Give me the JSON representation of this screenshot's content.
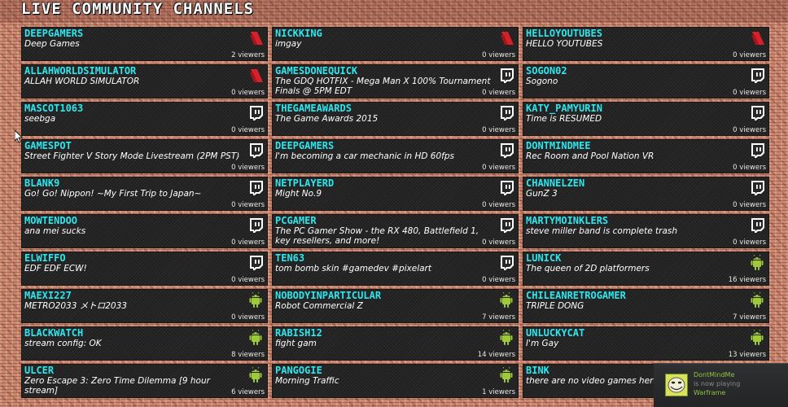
{
  "header": {
    "title": "Live Community Channels"
  },
  "viewers_suffix": "viewers",
  "channels": [
    {
      "name": "DeepGamers",
      "title": "Deep Games",
      "viewers": 2,
      "platform": "youtube"
    },
    {
      "name": "Nickking",
      "title": "imgay",
      "viewers": 0,
      "platform": "youtube"
    },
    {
      "name": "HelloYoutubes",
      "title": "HELLO YOUTUBES",
      "viewers": 0,
      "platform": "youtube"
    },
    {
      "name": "AllahWorldSimulator",
      "title": "ALLAH WORLD SIMULATOR",
      "viewers": 0,
      "platform": "youtube"
    },
    {
      "name": "GamesDoneQuick",
      "title": "The GDQ HOTFIX - Mega Man X 100% Tournament Finals @ 5PM EDT",
      "viewers": 0,
      "platform": "twitch"
    },
    {
      "name": "sogon02",
      "title": "Sogono",
      "viewers": 0,
      "platform": "twitch"
    },
    {
      "name": "mascot1063",
      "title": "seebga",
      "viewers": 0,
      "platform": "twitch"
    },
    {
      "name": "thegameawards",
      "title": "The Game Awards 2015",
      "viewers": 0,
      "platform": "twitch"
    },
    {
      "name": "katy_pamyurin",
      "title": "Time is RESUMED",
      "viewers": 0,
      "platform": "twitch"
    },
    {
      "name": "gamespot",
      "title": "Street Fighter V Story Mode Livestream (2PM PST)",
      "viewers": 0,
      "platform": "twitch"
    },
    {
      "name": "deepgamers",
      "title": "I'm becoming a car mechanic in HD 60fps",
      "viewers": 0,
      "platform": "twitch"
    },
    {
      "name": "dontmindmee",
      "title": "Rec Room and Pool Nation VR",
      "viewers": 0,
      "platform": "twitch"
    },
    {
      "name": "blank9",
      "title": "Go! Go! Nippon! ~My First Trip to Japan~",
      "viewers": 0,
      "platform": "twitch"
    },
    {
      "name": "netplayerd",
      "title": "Might No.9",
      "viewers": 0,
      "platform": "twitch"
    },
    {
      "name": "channelzen",
      "title": "GunZ 3",
      "viewers": 0,
      "platform": "twitch"
    },
    {
      "name": "mowtendoo",
      "title": "ana mei sucks",
      "viewers": 0,
      "platform": "twitch"
    },
    {
      "name": "pcgamer",
      "title": "The PC Gamer Show - the RX 480, Battlefield 1, key resellers, and more!",
      "viewers": 0,
      "platform": "twitch"
    },
    {
      "name": "martymoinklers",
      "title": "steve miller band is complete trash",
      "viewers": 0,
      "platform": "twitch"
    },
    {
      "name": "elwiffo",
      "title": "EDF EDF ECW!",
      "viewers": 0,
      "platform": "twitch"
    },
    {
      "name": "ten63",
      "title": "tom bomb skin #gamedev #pixelart",
      "viewers": 0,
      "platform": "twitch"
    },
    {
      "name": "Lunick",
      "title": "The queen of 2D platformers",
      "viewers": 16,
      "platform": "android"
    },
    {
      "name": "maexi227",
      "title": "METRO2033 メトロ2033",
      "viewers": 0,
      "platform": "android"
    },
    {
      "name": "nobodyinparticular",
      "title": "Robot Commercial Z",
      "viewers": 7,
      "platform": "android"
    },
    {
      "name": "ChileanRetroGamer",
      "title": "TRIPLE DONG",
      "viewers": 7,
      "platform": "android"
    },
    {
      "name": "blackwatch",
      "title": "stream config: OK",
      "viewers": 8,
      "platform": "android"
    },
    {
      "name": "Rabish12",
      "title": "fight gam",
      "viewers": 14,
      "platform": "android"
    },
    {
      "name": "UnluckyCat",
      "title": "I'm Gay",
      "viewers": 13,
      "platform": "android"
    },
    {
      "name": "Ulcer",
      "title": "Zero Escape 3: Zero Time Dilemma [9 hour stream]",
      "viewers": 6,
      "platform": "android"
    },
    {
      "name": "pangogie",
      "title": "Morning Traffic",
      "viewers": 1,
      "platform": "android"
    },
    {
      "name": "BINK",
      "title": "there are no video games here",
      "viewers": null,
      "platform": "android"
    }
  ],
  "notification": {
    "user": "DontMindMe",
    "status": "is now playing",
    "game": "Warframe"
  },
  "colors": {
    "channel_name": "#2ee6ee",
    "card_bg": "#262626",
    "youtube_red": "#d4212a",
    "android_green": "#9dc93a",
    "steam_green": "#8fc43f"
  },
  "icons": {
    "youtube": "youtube-gaming-icon",
    "twitch": "twitch-icon",
    "android": "android-icon"
  }
}
